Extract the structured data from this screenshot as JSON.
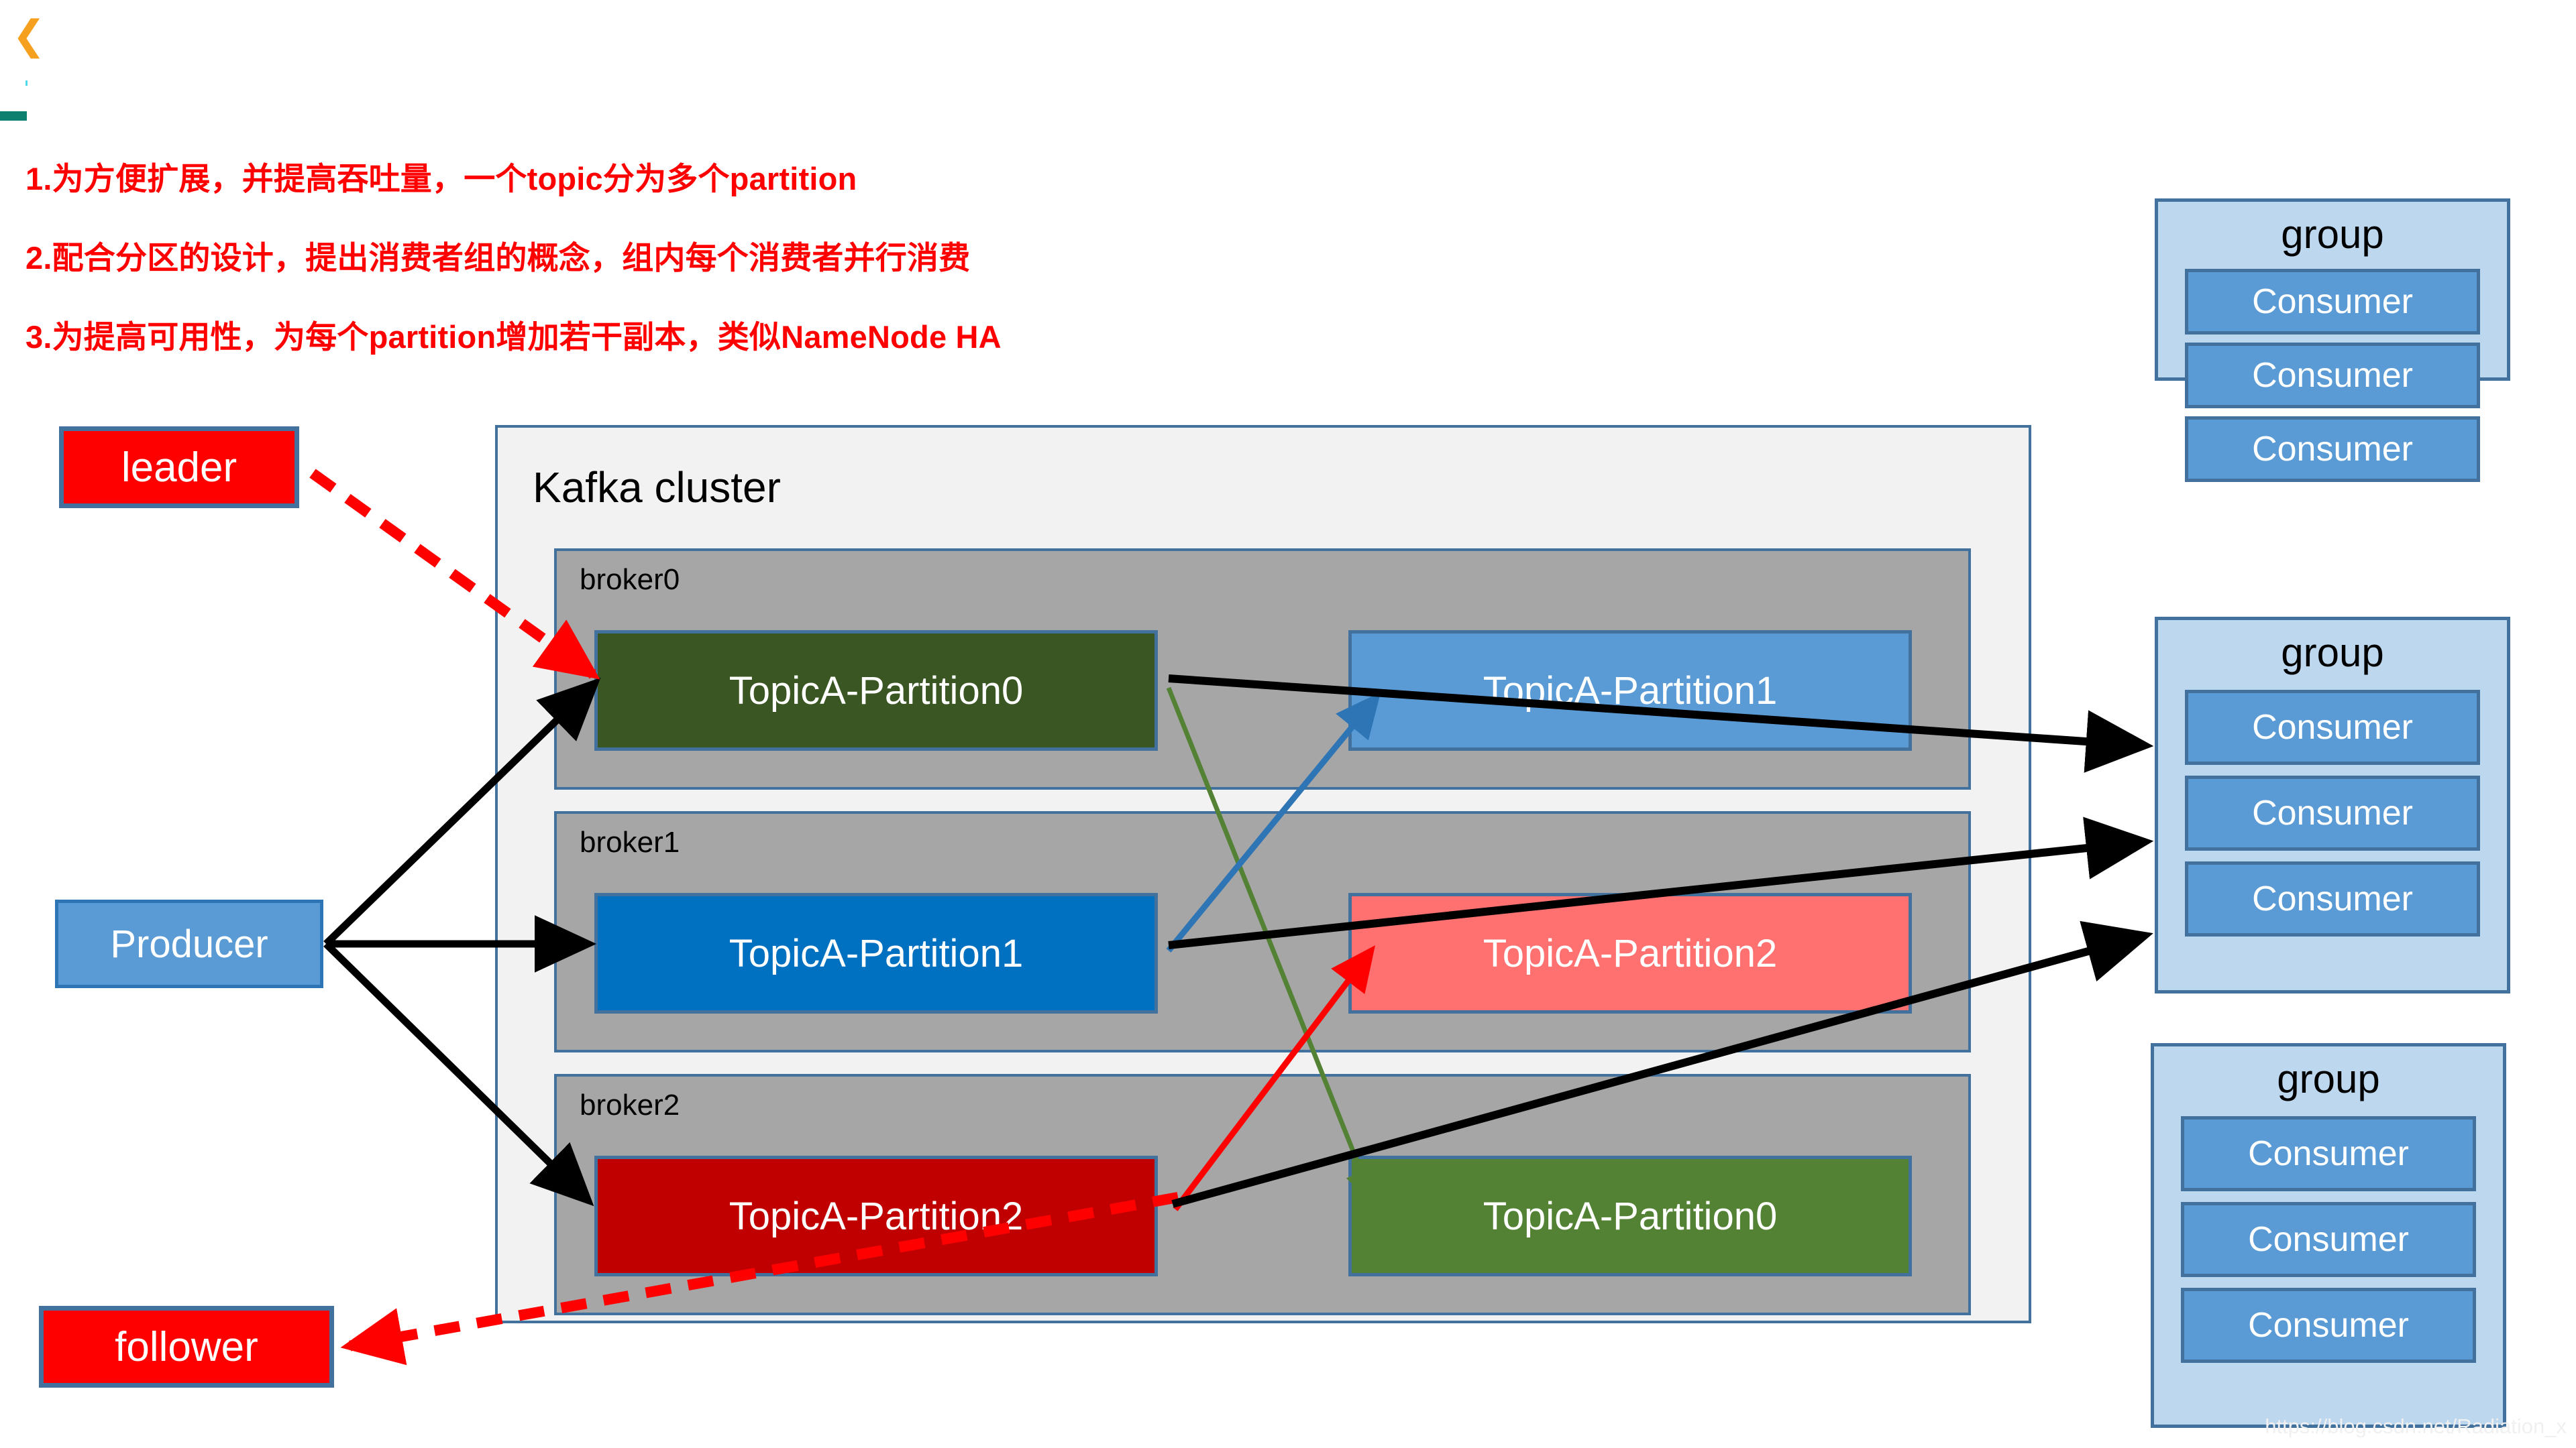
{
  "toolbar": {
    "back_icon": "chevron-left-icon",
    "accent_color": "#0E8070"
  },
  "notes": {
    "lines": [
      "1.为方便扩展，并提高吞吐量，一个topic分为多个partition",
      "2.配合分区的设计，提出消费者组的概念，组内每个消费者并行消费",
      "3.为提高可用性，为每个partition增加若干副本，类似NameNode HA"
    ],
    "color": "#FF0000"
  },
  "callouts": {
    "leader": "leader",
    "follower": "follower",
    "color": "#FF0000"
  },
  "producer": {
    "label": "Producer",
    "color": "#5B9BD5"
  },
  "cluster": {
    "title": "Kafka cluster",
    "background": "#F2F2F2",
    "border_color": "#41719C",
    "brokers": [
      {
        "label": "broker0",
        "partitions": [
          {
            "label": "TopicA-Partition0",
            "role": "leader",
            "color": "#3A5723"
          },
          {
            "label": "TopicA-Partition1",
            "role": "follower",
            "color": "#5B9BD5"
          }
        ]
      },
      {
        "label": "broker1",
        "partitions": [
          {
            "label": "TopicA-Partition1",
            "role": "leader",
            "color": "#0070C0"
          },
          {
            "label": "TopicA-Partition2",
            "role": "follower",
            "color": "#FF7070"
          }
        ]
      },
      {
        "label": "broker2",
        "partitions": [
          {
            "label": "TopicA-Partition2",
            "role": "leader",
            "color": "#C00000"
          },
          {
            "label": "TopicA-Partition0",
            "role": "follower",
            "color": "#548235"
          }
        ]
      }
    ]
  },
  "consumer_groups": [
    {
      "title": "group",
      "consumers": [
        "Consumer",
        "Consumer",
        "Consumer"
      ]
    },
    {
      "title": "group",
      "consumers": [
        "Consumer",
        "Consumer",
        "Consumer"
      ]
    },
    {
      "title": "group",
      "consumers": [
        "Consumer",
        "Consumer",
        "Consumer"
      ]
    }
  ],
  "arrows": {
    "producer_to_leaders": 3,
    "leaders_to_consumers": 3,
    "replication_links": [
      {
        "from": "broker0.TopicA-Partition0",
        "to": "broker2.TopicA-Partition0",
        "color": "#548235"
      },
      {
        "from": "broker1.TopicA-Partition1",
        "to": "broker0.TopicA-Partition1",
        "color": "#2E75B6"
      },
      {
        "from": "broker2.TopicA-Partition2",
        "to": "broker1.TopicA-Partition2",
        "color": "#FF0000"
      }
    ],
    "leader_callout_color": "#FF0000",
    "follower_callout_color": "#FF0000"
  },
  "watermark": "https://blog.csdn.net/Radiation_x"
}
